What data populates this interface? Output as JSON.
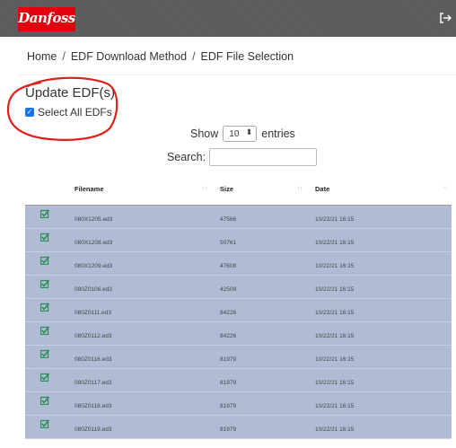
{
  "header": {
    "logo_text": "Danfoss",
    "brand_color": "#e2000f",
    "bar_color": "#5b5b5b",
    "logout_icon": "logout-icon"
  },
  "breadcrumb": [
    "Home",
    "EDF Download Method",
    "EDF File Selection"
  ],
  "breadcrumb_separator": "/",
  "panel": {
    "title": "Update EDF(s)",
    "select_all_label": "Select All EDFs",
    "select_all_checked": true
  },
  "entries": {
    "show_label": "Show",
    "value": "10",
    "suffix": "entries"
  },
  "search": {
    "label": "Search:",
    "value": "",
    "placeholder": ""
  },
  "table": {
    "columns": [
      "Filename",
      "Size",
      "Date"
    ],
    "rows": [
      {
        "checked": true,
        "filename": "080X1205.ed3",
        "size": "47566",
        "date": "10/22/21 16:15"
      },
      {
        "checked": true,
        "filename": "080X1208.ed3",
        "size": "50761",
        "date": "10/22/21 16:15"
      },
      {
        "checked": true,
        "filename": "080X1209.ed3",
        "size": "47608",
        "date": "10/22/21 16:15"
      },
      {
        "checked": true,
        "filename": "080Z0106.ed3",
        "size": "42509",
        "date": "10/22/21 16:15"
      },
      {
        "checked": true,
        "filename": "080Z0111.ed3",
        "size": "84226",
        "date": "10/22/21 16:15"
      },
      {
        "checked": true,
        "filename": "080Z0112.ed3",
        "size": "84226",
        "date": "10/22/21 16:15"
      },
      {
        "checked": true,
        "filename": "080Z0116.ed3",
        "size": "81979",
        "date": "10/22/21 16:15"
      },
      {
        "checked": true,
        "filename": "080Z0117.ed3",
        "size": "81979",
        "date": "10/22/21 16:15"
      },
      {
        "checked": true,
        "filename": "080Z0118.ed3",
        "size": "81979",
        "date": "10/22/21 16:15"
      },
      {
        "checked": true,
        "filename": "080Z0119.ed3",
        "size": "81979",
        "date": "10/22/21 16:15"
      }
    ],
    "row_selected_color": "#b0bbd6",
    "check_color": "#2e8b57"
  },
  "annotation_color": "#e0201a"
}
